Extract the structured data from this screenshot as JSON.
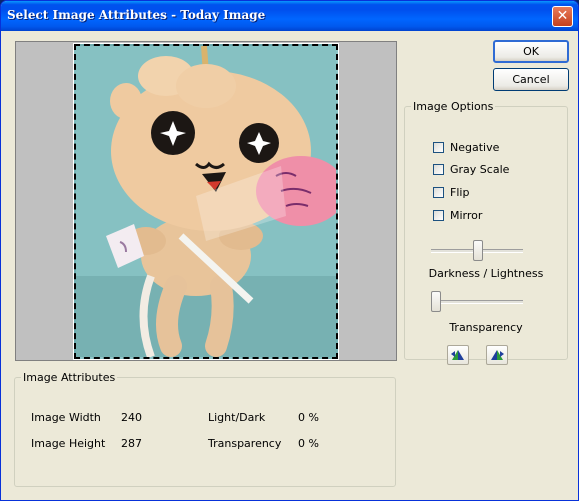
{
  "window": {
    "title": "Select Image Attributes - Today Image",
    "close_glyph": "✕"
  },
  "buttons": {
    "ok": "OK",
    "cancel": "Cancel"
  },
  "image_options": {
    "legend": "Image Options",
    "checkboxes": [
      {
        "label": "Negative",
        "checked": false
      },
      {
        "label": "Gray Scale",
        "checked": false
      },
      {
        "label": "Flip",
        "checked": false
      },
      {
        "label": "Mirror",
        "checked": false
      }
    ],
    "darkness_slider": {
      "label": "Darkness  /  Lightness",
      "value_fraction": 0.5
    },
    "transparency_slider": {
      "label": "Transparency",
      "value_fraction": 0.0
    },
    "icon_buttons": [
      "rotate-left-icon",
      "rotate-right-icon"
    ]
  },
  "image_attributes": {
    "legend": "Image Attributes",
    "width_label": "Image Width",
    "width_value": "240",
    "height_label": "Image Height",
    "height_value": "287",
    "lightdark_label": "Light/Dark",
    "lightdark_value": "0 %",
    "transparency_label": "Transparency",
    "transparency_value": "0 %"
  },
  "colors": {
    "title_bar": "#0054e3",
    "dialog_bg": "#ece9d8",
    "accent_button_border": "#2f6bd4"
  }
}
